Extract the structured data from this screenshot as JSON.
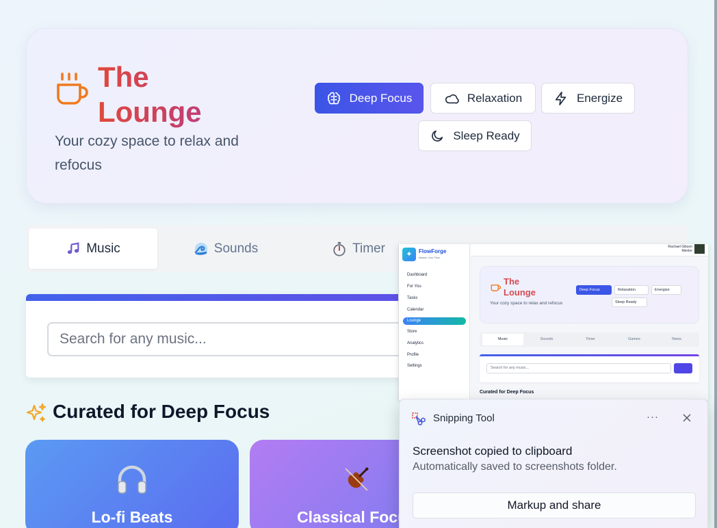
{
  "hero": {
    "title": "The Lounge",
    "subtitle": "Your cozy space to relax and refocus",
    "icon": "coffee-cup-icon",
    "moods": [
      {
        "label": "Deep Focus",
        "icon": "brain-icon",
        "active": true
      },
      {
        "label": "Relaxation",
        "icon": "cloud-icon",
        "active": false
      },
      {
        "label": "Energize",
        "icon": "lightning-icon",
        "active": false
      },
      {
        "label": "Sleep Ready",
        "icon": "moon-icon",
        "active": false
      }
    ]
  },
  "tabs": [
    {
      "label": "Music",
      "icon": "music-note-icon",
      "active": true
    },
    {
      "label": "Sounds",
      "icon": "wave-icon",
      "active": false
    },
    {
      "label": "Timer",
      "icon": "stopwatch-icon",
      "active": false
    }
  ],
  "search": {
    "placeholder": "Search for any music..."
  },
  "section": {
    "title": "Curated for Deep Focus",
    "icon": "sparkles-icon"
  },
  "cards": [
    {
      "title": "Lo-fi Beats",
      "icon": "headphones-icon"
    },
    {
      "title": "Classical Focus",
      "icon": "violin-icon"
    }
  ],
  "thumbnail": {
    "brand": "FlowForge",
    "brand_sub": "Master Your Flow",
    "user_name": "Rachael Gibson",
    "user_role": "Mentor",
    "nav": [
      "Dashboard",
      "For You",
      "Tasks",
      "Calendar",
      "Lounge",
      "Store",
      "Analytics",
      "Profile",
      "Settings"
    ],
    "active_nav": "Lounge",
    "hero_title_line1": "The",
    "hero_title_line2": "Lounge",
    "hero_sub": "Your cozy space to relax and refocus",
    "moods": [
      "Deep Focus",
      "Relaxation",
      "Energize",
      "Sleep Ready"
    ],
    "tabs": [
      "Music",
      "Sounds",
      "Timer",
      "Games",
      "News"
    ],
    "search_placeholder": "Search for any music...",
    "section_title": "Curated for Deep Focus"
  },
  "toast": {
    "app_name": "Snipping Tool",
    "more": "···",
    "heading": "Screenshot copied to clipboard",
    "body": "Automatically saved to screenshots folder.",
    "action": "Markup and share"
  },
  "colors": {
    "accent": "#3b55e6",
    "title_gradient_start": "#e0483b",
    "title_gradient_end": "#b93c86",
    "cup": "#f07a1e",
    "card1": "#5b8af0",
    "card2": "#b07cf0"
  }
}
